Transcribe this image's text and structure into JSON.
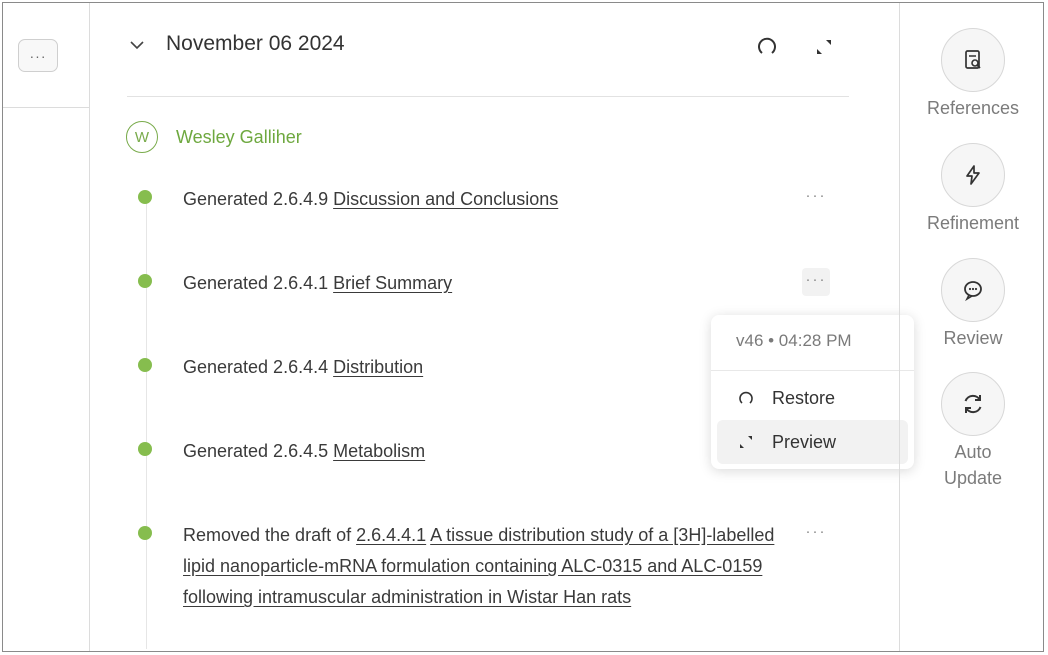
{
  "left": {
    "more_label": "···"
  },
  "header": {
    "date": "November 06 2024",
    "collapse_icon": "chevron-down-icon",
    "restore_icon": "restore-icon",
    "expand_icon": "expand-icon"
  },
  "author": {
    "initial": "W",
    "name": "Wesley Galliher"
  },
  "entries": [
    {
      "prefix": "Generated 2.6.4.9 ",
      "link": "Discussion and Conclusions",
      "more": "···"
    },
    {
      "prefix": "Generated 2.6.4.1 ",
      "link": "Brief Summary",
      "more": "···"
    },
    {
      "prefix": "Generated 2.6.4.4 ",
      "link": "Distribution"
    },
    {
      "prefix": "Generated 2.6.4.5 ",
      "link": "Metabolism"
    },
    {
      "prefix": "Removed the draft of ",
      "link_a": "2.6.4.4.1",
      "link_b": "A tissue distribution study of a [3H]-labelled lipid nanoparticle-mRNA formulation containing ALC-0315 and ALC-0159 following intramuscular administration in Wistar Han rats",
      "more": "···"
    }
  ],
  "popup": {
    "version": "v46 • 04:28 PM",
    "items": [
      {
        "label": "Restore",
        "icon": "restore-icon"
      },
      {
        "label": "Preview",
        "icon": "expand-icon"
      }
    ]
  },
  "rail": [
    {
      "label": "References",
      "icon": "document-search-icon"
    },
    {
      "label": "Refinement",
      "icon": "lightning-icon"
    },
    {
      "label": "Review",
      "icon": "chat-bubble-icon"
    },
    {
      "label": "Auto Update",
      "icon": "refresh-icon"
    }
  ],
  "colors": {
    "accent_green": "#86bd4e",
    "author_green": "#6ea83f"
  }
}
